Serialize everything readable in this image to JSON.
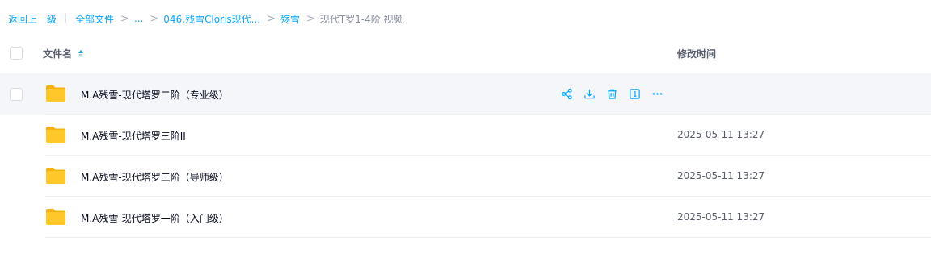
{
  "breadcrumb": {
    "back_label": "返回上一级",
    "items": [
      {
        "label": "全部文件"
      },
      {
        "label": "..."
      },
      {
        "label": "046.残雪Cloris现代..."
      },
      {
        "label": "殇雪"
      }
    ],
    "current": "现代T罗1-4阶 视频"
  },
  "table": {
    "col_name": "文件名",
    "col_time": "修改时间",
    "rows": [
      {
        "name": "M.A残雪-现代塔罗二阶（专业级）",
        "time": "",
        "icon": "folder-icon",
        "hovered": true
      },
      {
        "name": "M.A残雪-现代塔罗三阶II",
        "time": "2025-05-11 13:27",
        "icon": "folder-icon"
      },
      {
        "name": "M.A残雪-现代塔罗三阶（导师级）",
        "time": "2025-05-11 13:27",
        "icon": "folder-icon"
      },
      {
        "name": "M.A残雪-现代塔罗一阶（入门级）",
        "time": "2025-05-11 13:27",
        "icon": "folder-icon"
      }
    ]
  },
  "row_actions": [
    "share-icon",
    "download-icon",
    "delete-icon",
    "info-icon",
    "more-icon"
  ],
  "colors": {
    "accent": "#06a7ff",
    "folder": "#ffc82a",
    "row_hover": "#f4f6fa"
  }
}
